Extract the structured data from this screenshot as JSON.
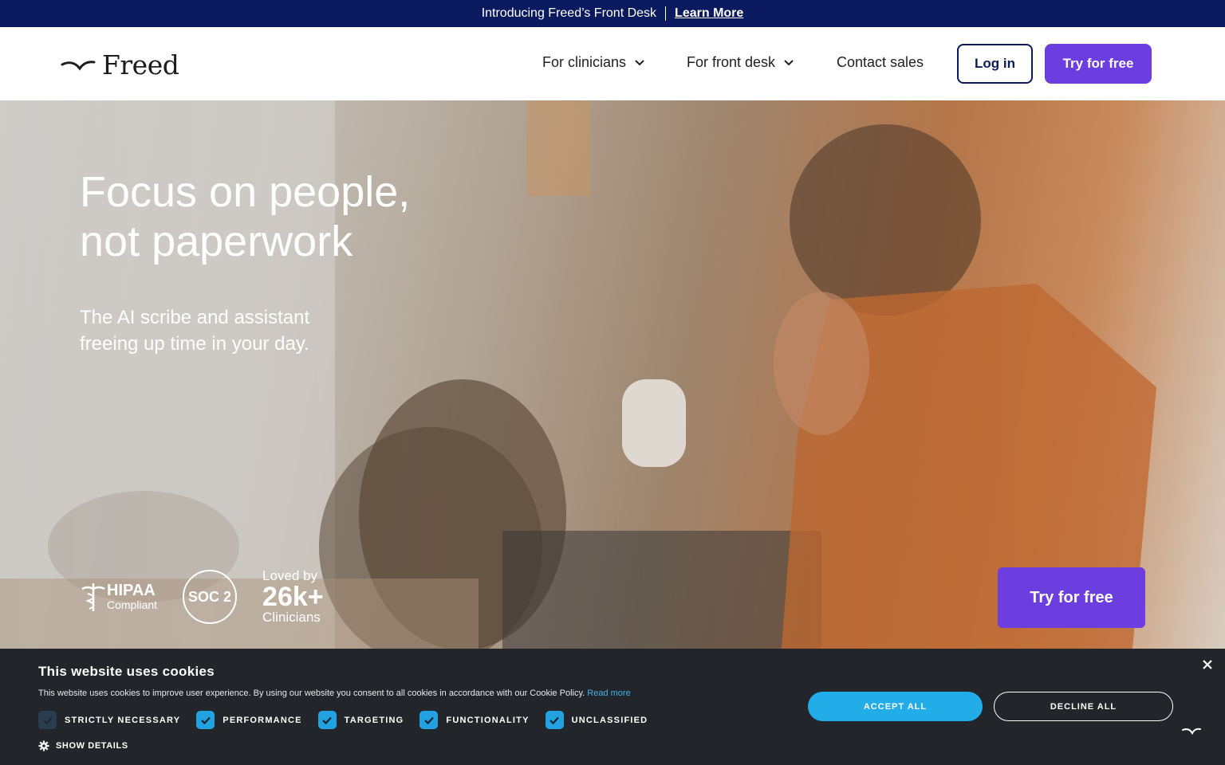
{
  "announcement": {
    "text": "Introducing Freed’s Front Desk",
    "link": "Learn More"
  },
  "header": {
    "logo": "Freed",
    "nav": [
      "For clinicians",
      "For front desk",
      "Contact sales"
    ],
    "login": "Log in",
    "try": "Try for free"
  },
  "hero": {
    "headline_1": "Focus on people,",
    "headline_2": "not paperwork",
    "subhead": "The AI scribe and assistant freeing up time in your day.",
    "hipaa_1": "HIPAA",
    "hipaa_2": "Compliant",
    "soc": "SOC 2",
    "loved_1": "Loved by",
    "loved_2": "26k+",
    "loved_3": "Clinicians",
    "cta": "Try for free"
  },
  "cookie": {
    "title": "This website uses cookies",
    "text": "This website uses cookies to improve user experience. By using our website you consent to all cookies in accordance with our Cookie Policy.",
    "read_more": "Read more",
    "checks": [
      "STRICTLY NECESSARY",
      "PERFORMANCE",
      "TARGETING",
      "FUNCTIONALITY",
      "UNCLASSIFIED"
    ],
    "show_details": "SHOW DETAILS",
    "accept": "ACCEPT ALL",
    "decline": "DECLINE ALL"
  },
  "colors": {
    "navy": "#0b1a5e",
    "purple": "#6c3ee0",
    "cookie_bg": "#22262b",
    "accent_blue": "#22ade8"
  }
}
